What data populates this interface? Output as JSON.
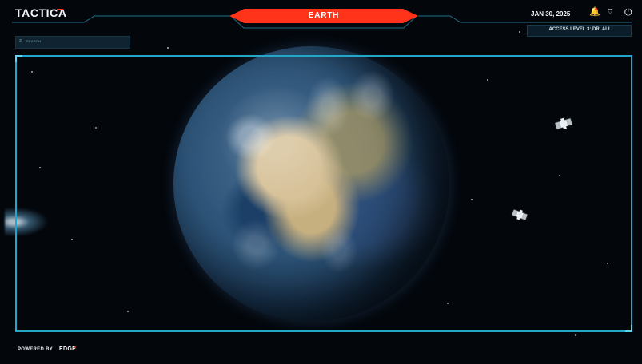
{
  "header": {
    "logo": "TACTICA",
    "title": "EARTH",
    "date": "JAN 30, 2025",
    "access": "ACCESS LEVEL 3: DR. ALI"
  },
  "search": {
    "label": "SEARCH"
  },
  "footer": {
    "powered_by": "POWERED BY",
    "brand": "EDGE"
  },
  "icons": {
    "bell": "bell-icon",
    "wifi": "wifi-icon",
    "power": "power-icon",
    "search": "search-icon",
    "satellite": "satellite-icon"
  },
  "colors": {
    "accent": "#ff3319",
    "frame": "#22a7c7",
    "background": "#03070c"
  }
}
